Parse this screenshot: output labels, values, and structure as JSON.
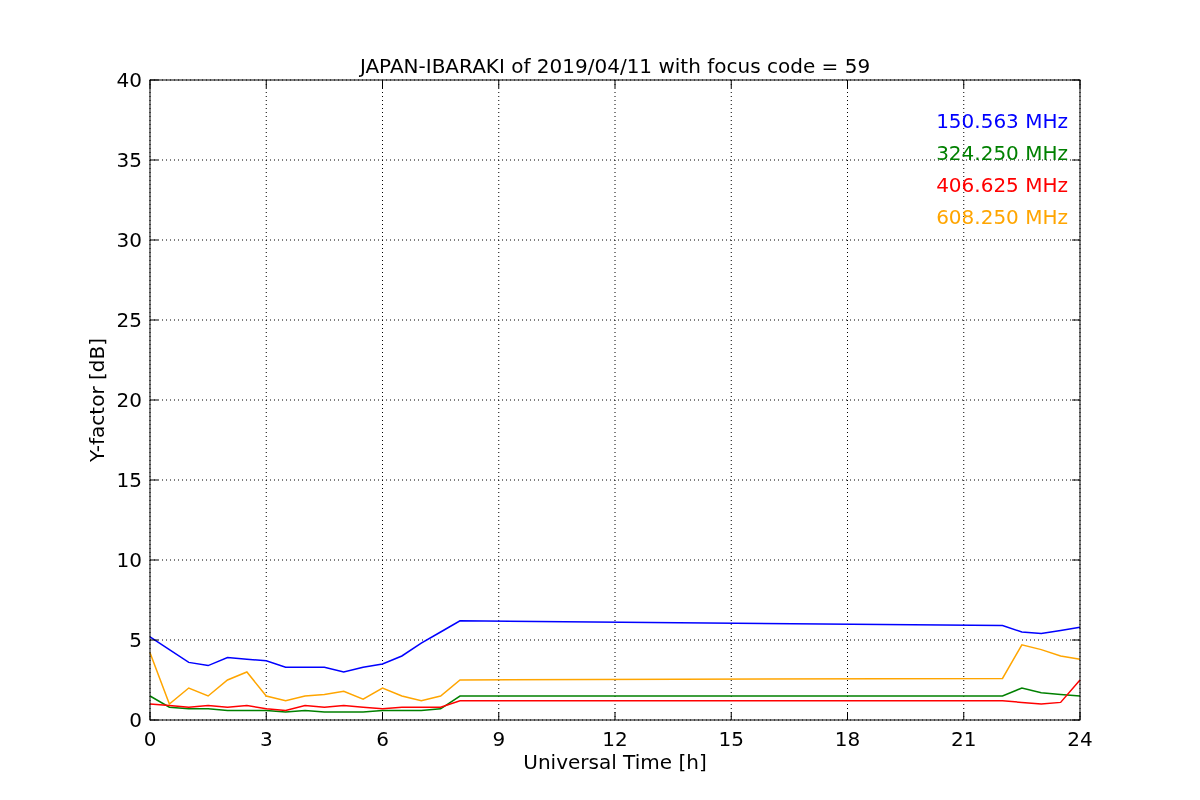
{
  "figure": {
    "chart_data": {
      "type": "line",
      "title": "JAPAN-IBARAKI of 2019/04/11 with focus code = 59",
      "xlabel": "Universal Time [h]",
      "ylabel": "Y-factor [dB]",
      "x": [
        0,
        0.5,
        1,
        1.5,
        2,
        2.5,
        3,
        3.5,
        4,
        4.5,
        5,
        5.5,
        6,
        6.5,
        7,
        7.5,
        8,
        22,
        22.5,
        23,
        23.5,
        24
      ],
      "series": [
        {
          "name": "150.563 MHz",
          "color": "#0000ff",
          "values": [
            5.2,
            4.4,
            3.6,
            3.4,
            3.9,
            3.8,
            3.7,
            3.3,
            3.3,
            3.3,
            3.0,
            3.3,
            3.5,
            4.0,
            4.8,
            5.5,
            6.2,
            5.9,
            5.5,
            5.4,
            5.6,
            5.8
          ]
        },
        {
          "name": "324.250 MHz",
          "color": "#008000",
          "values": [
            1.5,
            0.8,
            0.7,
            0.7,
            0.6,
            0.6,
            0.6,
            0.5,
            0.6,
            0.5,
            0.5,
            0.5,
            0.6,
            0.6,
            0.6,
            0.7,
            1.5,
            1.5,
            2.0,
            1.7,
            1.6,
            1.5
          ]
        },
        {
          "name": "406.625 MHz",
          "color": "#ff0000",
          "values": [
            1.0,
            0.9,
            0.8,
            0.9,
            0.8,
            0.9,
            0.7,
            0.6,
            0.9,
            0.8,
            0.9,
            0.8,
            0.7,
            0.8,
            0.8,
            0.8,
            1.2,
            1.2,
            1.1,
            1.0,
            1.1,
            2.5
          ]
        },
        {
          "name": "608.250 MHz",
          "color": "#ffa500",
          "values": [
            4.2,
            1.0,
            2.0,
            1.5,
            2.5,
            3.0,
            1.5,
            1.2,
            1.5,
            1.6,
            1.8,
            1.3,
            2.0,
            1.5,
            1.2,
            1.5,
            2.5,
            2.6,
            4.7,
            4.4,
            4.0,
            3.8
          ]
        }
      ],
      "grid": true,
      "xlim": [
        0,
        24
      ],
      "ylim": [
        0,
        40
      ],
      "xticks": [
        0,
        3,
        6,
        9,
        12,
        15,
        18,
        21,
        24
      ],
      "yticks": [
        0,
        5,
        10,
        15,
        20,
        25,
        30,
        35,
        40
      ]
    }
  }
}
